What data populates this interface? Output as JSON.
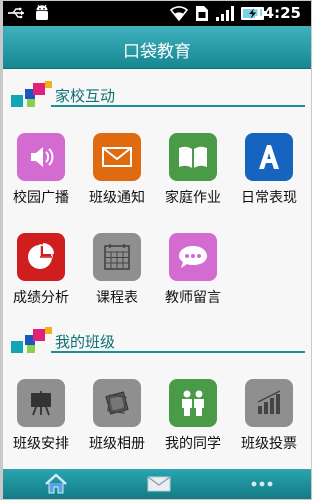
{
  "status_bar": {
    "time": "14:25",
    "icons": [
      "usb-icon",
      "android-debug-icon",
      "wifi-icon",
      "sim-icon",
      "signal-icon",
      "battery-charging-icon"
    ]
  },
  "header": {
    "title": "口袋教育"
  },
  "sections": [
    {
      "title": "家校互动",
      "items": [
        {
          "label": "校园广播",
          "icon": "speaker-icon",
          "color": "#d36bd0"
        },
        {
          "label": "班级通知",
          "icon": "envelope-icon",
          "color": "#e06a10"
        },
        {
          "label": "家庭作业",
          "icon": "book-icon",
          "color": "#4a9b48"
        },
        {
          "label": "日常表现",
          "icon": "letter-a-icon",
          "color": "#1565c0"
        },
        {
          "label": "成绩分析",
          "icon": "pie-chart-icon",
          "color": "#d01e1e"
        },
        {
          "label": "课程表",
          "icon": "calendar-icon",
          "color": "#8f8f8f"
        },
        {
          "label": "教师留言",
          "icon": "chat-bubble-icon",
          "color": "#d36bd0"
        }
      ]
    },
    {
      "title": "我的班级",
      "items": [
        {
          "label": "班级安排",
          "icon": "easel-icon",
          "color": "#8f8f8f"
        },
        {
          "label": "班级相册",
          "icon": "photo-album-icon",
          "color": "#8f8f8f"
        },
        {
          "label": "我的同学",
          "icon": "classmates-icon",
          "color": "#4a9b48"
        },
        {
          "label": "班级投票",
          "icon": "bar-chart-icon",
          "color": "#8f8f8f"
        }
      ]
    }
  ],
  "bottom_nav": [
    {
      "icon": "home-icon"
    },
    {
      "icon": "mail-icon"
    },
    {
      "icon": "more-icon"
    }
  ],
  "colors": {
    "accent": "#1e8d96",
    "title_bar": "#2a9aa5"
  }
}
